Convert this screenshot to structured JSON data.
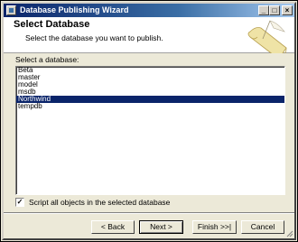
{
  "window": {
    "title": "Database Publishing Wizard",
    "controls": {
      "minimize": "_",
      "maximize": "□",
      "close": "×"
    }
  },
  "header": {
    "title": "Select Database",
    "subtitle": "Select the database you want to publish.",
    "art_icon": "scroll-quill-icon"
  },
  "list": {
    "label": "Select a database:",
    "items": [
      "Beta",
      "master",
      "model",
      "msdb",
      "Northwind",
      "tempdb"
    ],
    "selected": "Northwind"
  },
  "script_all": {
    "checked": true,
    "check_glyph": "✓",
    "label": "Script all objects in the selected database"
  },
  "buttons": {
    "back": "< Back",
    "next": "Next >",
    "finish": "Finish >>|",
    "cancel": "Cancel"
  },
  "colors": {
    "selection": "#0a246a",
    "titlebar_start": "#0a246a",
    "titlebar_end": "#a6caf0",
    "dialog_bg": "#ece9d8"
  }
}
